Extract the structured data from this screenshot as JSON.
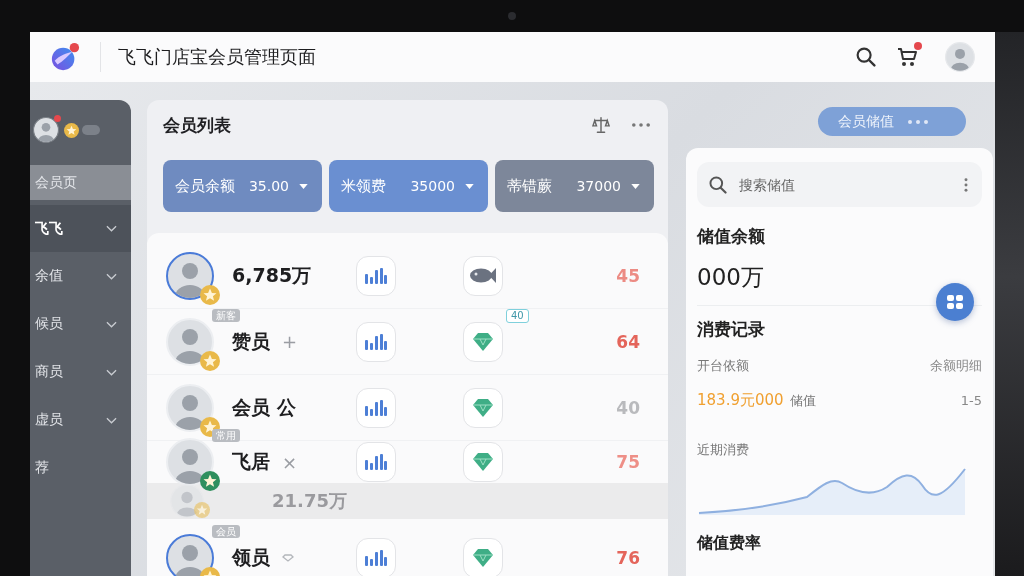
{
  "topbar": {
    "title": "飞飞门店宝会员管理页面",
    "cart_alert": true
  },
  "sidebar": {
    "profile": {
      "alert": true
    },
    "items": [
      {
        "label": "会员页",
        "selected": true,
        "highlighted": false,
        "has_menu": false
      },
      {
        "label": "飞飞",
        "selected": false,
        "highlighted": true,
        "has_menu": true
      },
      {
        "label": "余值",
        "selected": false,
        "highlighted": false,
        "has_menu": true
      },
      {
        "label": "候员",
        "selected": false,
        "highlighted": false,
        "has_menu": true
      },
      {
        "label": "商员",
        "selected": false,
        "highlighted": false,
        "has_menu": true
      },
      {
        "label": "虚员",
        "selected": false,
        "highlighted": false,
        "has_menu": true
      },
      {
        "label": "荐",
        "selected": false,
        "highlighted": false,
        "has_menu": false
      }
    ]
  },
  "member_list": {
    "title": "会员列表",
    "filters": [
      {
        "label": "会员余额",
        "value": "35.00",
        "color": "#6f8bc0"
      },
      {
        "label": "米领费",
        "value": "35000",
        "color": "#6a8fd1"
      },
      {
        "label": "蒂错蕨",
        "value": "37000",
        "color": "#7d879a"
      }
    ],
    "members": [
      {
        "name": "6,785万",
        "highlighted": true,
        "badge": {
          "color": "#e9b949"
        },
        "reward": {
          "kind": "fish"
        },
        "score": {
          "text": "45",
          "color": "#ec8b84"
        }
      },
      {
        "name": "赞员",
        "tag": "新客",
        "mark": {
          "kind": "text",
          "text": "+"
        },
        "highlighted": false,
        "badge": {
          "color": "#e9b949"
        },
        "reward": {
          "kind": "gem",
          "badge": "40"
        },
        "score": {
          "text": "64",
          "color": "#e4655b"
        }
      },
      {
        "name": "会员 公",
        "highlighted": false,
        "badge": {
          "color": "#e9b949"
        },
        "reward": {
          "kind": "gem"
        },
        "score": {
          "text": "40",
          "color": "#b9babd"
        }
      },
      {
        "name": "飞居",
        "tag": "常用",
        "mark": {
          "kind": "text",
          "text": "×"
        },
        "highlighted": false,
        "badge": {
          "color": "#2f8f5e"
        },
        "reward": {
          "kind": "gem"
        },
        "score": {
          "text": "75",
          "color": "#ee8f87"
        },
        "ghost_value": "21.75万"
      },
      {
        "name": "领员",
        "tag": "会员",
        "mark": {
          "kind": "diamond"
        },
        "highlighted": true,
        "badge": {
          "color": "#e9b949"
        },
        "reward": {
          "kind": "gem"
        },
        "score": {
          "text": "76",
          "color": "#e4655b"
        }
      }
    ]
  },
  "balance_panel": {
    "action_button": "会员储值",
    "search": {
      "placeholder": "搜索储值"
    },
    "balance_title": "储值余额",
    "balance": "000万",
    "records_title": "消费记录",
    "records": [
      {
        "kind": "caption",
        "label": "开台依额",
        "right": "余额明细"
      },
      {
        "kind": "amount",
        "amount": "183.9元000",
        "label": "储值",
        "right": "1-5"
      }
    ],
    "trend_title": "近期消费",
    "fee_title": "储值费率"
  }
}
